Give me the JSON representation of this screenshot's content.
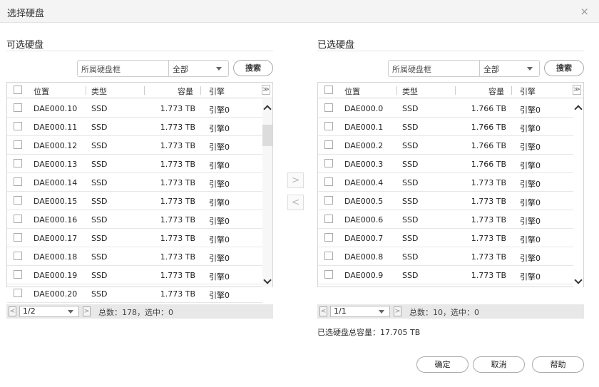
{
  "dialog": {
    "title": "选择硬盘",
    "close_symbol": "×"
  },
  "left": {
    "title": "可选硬盘",
    "filter": {
      "placeholder": "所属硬盘框",
      "select": "全部",
      "search_label": "搜索"
    },
    "columns": [
      "位置",
      "类型",
      "容量",
      "引擎"
    ],
    "rows": [
      {
        "pos": "DAE000.10",
        "type": "SSD",
        "cap": "1.773 TB",
        "eng": "引擎0"
      },
      {
        "pos": "DAE000.11",
        "type": "SSD",
        "cap": "1.773 TB",
        "eng": "引擎0"
      },
      {
        "pos": "DAE000.12",
        "type": "SSD",
        "cap": "1.773 TB",
        "eng": "引擎0"
      },
      {
        "pos": "DAE000.13",
        "type": "SSD",
        "cap": "1.773 TB",
        "eng": "引擎0"
      },
      {
        "pos": "DAE000.14",
        "type": "SSD",
        "cap": "1.773 TB",
        "eng": "引擎0"
      },
      {
        "pos": "DAE000.15",
        "type": "SSD",
        "cap": "1.773 TB",
        "eng": "引擎0"
      },
      {
        "pos": "DAE000.16",
        "type": "SSD",
        "cap": "1.773 TB",
        "eng": "引擎0"
      },
      {
        "pos": "DAE000.17",
        "type": "SSD",
        "cap": "1.773 TB",
        "eng": "引擎0"
      },
      {
        "pos": "DAE000.18",
        "type": "SSD",
        "cap": "1.773 TB",
        "eng": "引擎0"
      },
      {
        "pos": "DAE000.19",
        "type": "SSD",
        "cap": "1.773 TB",
        "eng": "引擎0"
      },
      {
        "pos": "DAE000.20",
        "type": "SSD",
        "cap": "1.773 TB",
        "eng": "引擎0"
      }
    ],
    "pager": {
      "page": "1/2",
      "summary": "总数：178，选中：0"
    }
  },
  "right": {
    "title": "已选硬盘",
    "filter": {
      "placeholder": "所属硬盘框",
      "select": "全部",
      "search_label": "搜索"
    },
    "columns": [
      "位置",
      "类型",
      "容量",
      "引擎"
    ],
    "rows": [
      {
        "pos": "DAE000.0",
        "type": "SSD",
        "cap": "1.766 TB",
        "eng": "引擎0"
      },
      {
        "pos": "DAE000.1",
        "type": "SSD",
        "cap": "1.766 TB",
        "eng": "引擎0"
      },
      {
        "pos": "DAE000.2",
        "type": "SSD",
        "cap": "1.766 TB",
        "eng": "引擎0"
      },
      {
        "pos": "DAE000.3",
        "type": "SSD",
        "cap": "1.766 TB",
        "eng": "引擎0"
      },
      {
        "pos": "DAE000.4",
        "type": "SSD",
        "cap": "1.773 TB",
        "eng": "引擎0"
      },
      {
        "pos": "DAE000.5",
        "type": "SSD",
        "cap": "1.773 TB",
        "eng": "引擎0"
      },
      {
        "pos": "DAE000.6",
        "type": "SSD",
        "cap": "1.773 TB",
        "eng": "引擎0"
      },
      {
        "pos": "DAE000.7",
        "type": "SSD",
        "cap": "1.773 TB",
        "eng": "引擎0"
      },
      {
        "pos": "DAE000.8",
        "type": "SSD",
        "cap": "1.773 TB",
        "eng": "引擎0"
      },
      {
        "pos": "DAE000.9",
        "type": "SSD",
        "cap": "1.773 TB",
        "eng": "引擎0"
      }
    ],
    "pager": {
      "page": "1/1",
      "summary": "总数：10，选中：0"
    }
  },
  "transfer": {
    "add_symbol": ">",
    "remove_symbol": "<"
  },
  "total_capacity": "已选硬盘总容量：17.705 TB",
  "buttons": {
    "ok": "确定",
    "cancel": "取消",
    "help": "帮助"
  },
  "icons": {
    "close": "close-icon",
    "scroll_up": "chevron-up-icon",
    "scroll_down": "chevron-down-icon",
    "column_menu": "double-chevron-down-icon"
  }
}
